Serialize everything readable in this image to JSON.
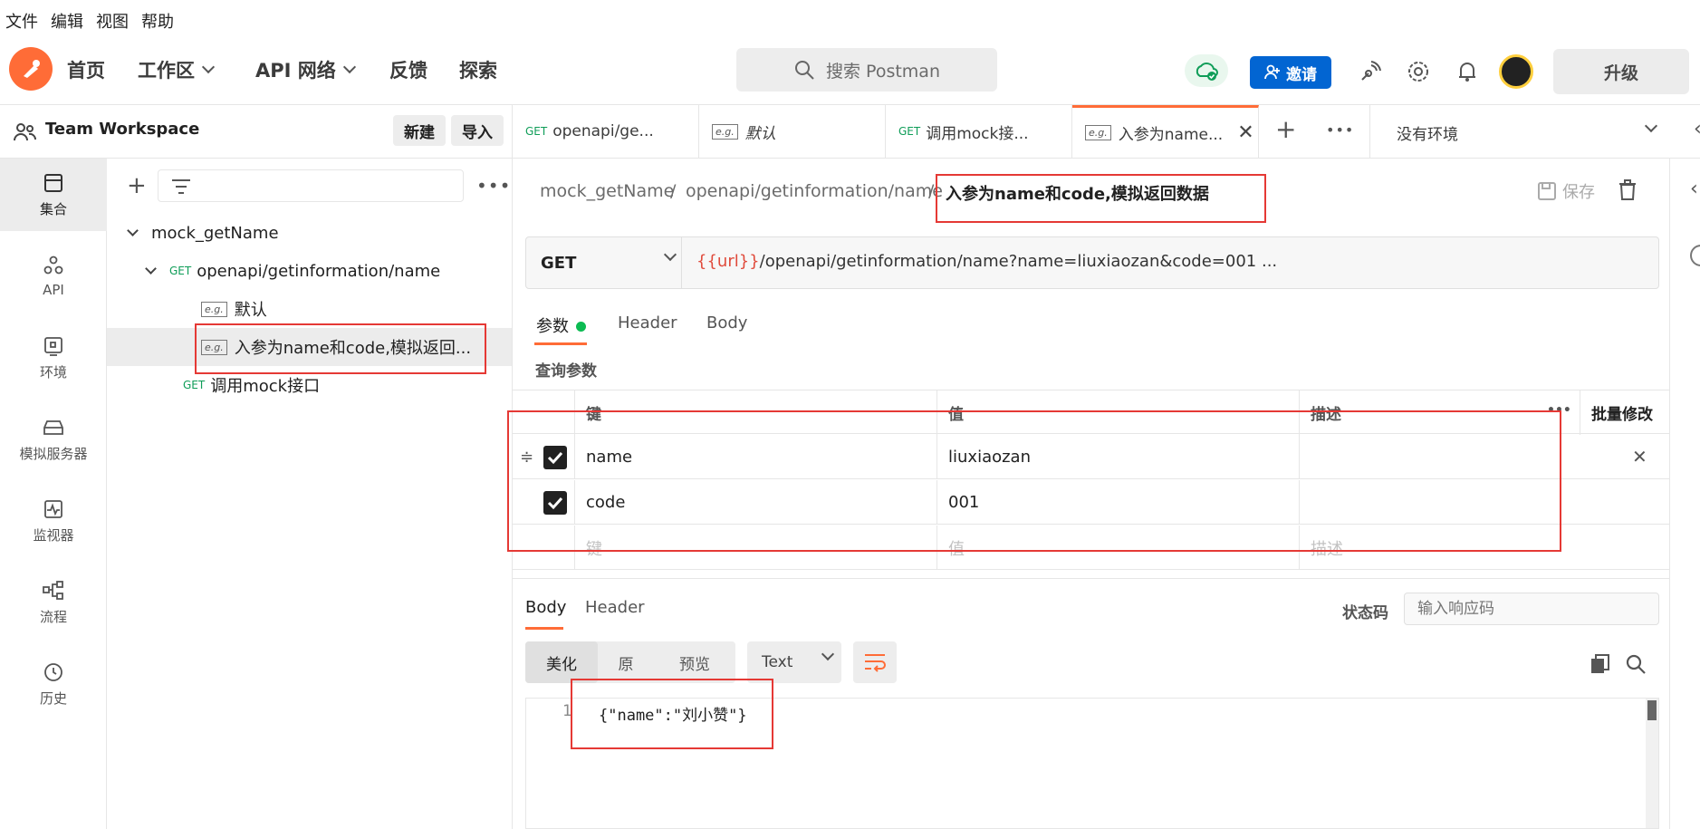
{
  "menubar": {
    "items": [
      "文件",
      "编辑",
      "视图",
      "帮助"
    ]
  },
  "header": {
    "nav": [
      {
        "label": "首页"
      },
      {
        "label": "工作区"
      },
      {
        "label": "API 网络"
      },
      {
        "label": "反馈"
      },
      {
        "label": "探索"
      }
    ],
    "search_placeholder": "搜索 Postman",
    "invite_label": "邀请",
    "upgrade_label": "升级",
    "accent": "#ff6c37",
    "invite_color": "#0265d2"
  },
  "workspace": {
    "title": "Team Workspace",
    "new_label": "新建",
    "import_label": "导入"
  },
  "rail": [
    {
      "label": "集合",
      "icon": "collection-icon"
    },
    {
      "label": "API",
      "icon": "api-icon"
    },
    {
      "label": "环境",
      "icon": "environment-icon"
    },
    {
      "label": "模拟服务器",
      "icon": "mock-server-icon"
    },
    {
      "label": "监视器",
      "icon": "monitor-icon"
    },
    {
      "label": "流程",
      "icon": "flow-icon"
    },
    {
      "label": "历史",
      "icon": "history-icon"
    }
  ],
  "tree": {
    "collection": "mock_getName",
    "request": {
      "method": "GET",
      "label": "openapi/getinformation/name"
    },
    "examples": [
      {
        "tag": "e.g.",
        "label": "默认"
      },
      {
        "tag": "e.g.",
        "label": "入参为name和code,模拟返回..."
      }
    ],
    "request2": {
      "method": "GET",
      "label": "调用mock接口"
    }
  },
  "tabs": [
    {
      "method": "GET",
      "label": "openapi/ge..."
    },
    {
      "tag": "e.g.",
      "label": "默认"
    },
    {
      "method": "GET",
      "label": "调用mock接..."
    },
    {
      "tag": "e.g.",
      "label": "入参为name..."
    }
  ],
  "env": {
    "label": "没有环境"
  },
  "breadcrumb": {
    "parts": [
      "mock_getName",
      "openapi/getinformation/name"
    ],
    "current": "入参为name和code,模拟返回数据",
    "sep": "/",
    "save_label": "保存"
  },
  "request": {
    "method": "GET",
    "url_var": "{{url}}",
    "url_rest": "/openapi/getinformation/name?name=liuxiaozan&code=001 ..."
  },
  "request_tabs": [
    "参数",
    "Header",
    "Body"
  ],
  "query_title": "查询参数",
  "params": {
    "headers": {
      "key": "键",
      "value": "值",
      "desc": "描述",
      "bulk": "批量修改"
    },
    "rows": [
      {
        "key": "name",
        "value": "liuxiaozan",
        "checked": true
      },
      {
        "key": "code",
        "value": "001",
        "checked": true
      }
    ],
    "placeholder": {
      "key": "键",
      "value": "值",
      "desc": "描述"
    }
  },
  "response": {
    "tabs": [
      "Body",
      "Header"
    ],
    "status_label": "状态码",
    "status_placeholder": "输入响应码",
    "views": [
      "美化",
      "原",
      "预览"
    ],
    "format": "Text",
    "line_no": "1",
    "body": "{\"name\":\"刘小赞\"}"
  }
}
